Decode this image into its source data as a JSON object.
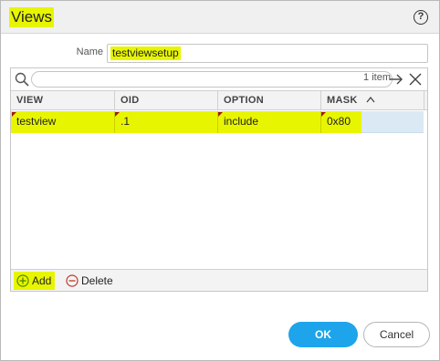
{
  "dialog": {
    "title": "Views",
    "help_icon": "help-icon",
    "help_text": "?"
  },
  "name_field": {
    "label": "Name",
    "value": "testviewsetup"
  },
  "search": {
    "placeholder": "",
    "count": "1 item"
  },
  "table": {
    "columns": [
      "VIEW",
      "OID",
      "OPTION",
      "MASK"
    ],
    "sort_indicator": "^",
    "rows": [
      {
        "view": "testview",
        "oid": ".1",
        "option": "include",
        "mask": "0x80"
      }
    ]
  },
  "footer": {
    "add_label": "Add",
    "delete_label": "Delete"
  },
  "buttons": {
    "ok": "OK",
    "cancel": "Cancel"
  },
  "colors": {
    "highlight": "#e8f500",
    "primary_button": "#1ea4ea",
    "selected_row_tail": "#dbe9f5"
  }
}
